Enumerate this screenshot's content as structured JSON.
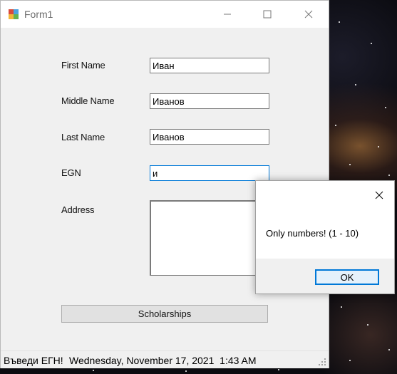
{
  "window": {
    "title": "Form1"
  },
  "form": {
    "fields": [
      {
        "label": "First Name",
        "value": "Иван"
      },
      {
        "label": "Middle Name",
        "value": "Иванов"
      },
      {
        "label": "Last Name",
        "value": "Иванов"
      },
      {
        "label": "EGN",
        "value": "и"
      }
    ],
    "address_label": "Address",
    "address_value": "",
    "scholarships_button": "Scholarships"
  },
  "statusbar": {
    "hint": "Въведи ЕГН!",
    "datetime": "Wednesday, November 17, 2021  1:43 AM"
  },
  "messagebox": {
    "message": "Only numbers! (1 - 10)",
    "ok_label": "OK"
  },
  "colors": {
    "focus_accent": "#0078d7",
    "window_bg": "#f0f0f0"
  }
}
